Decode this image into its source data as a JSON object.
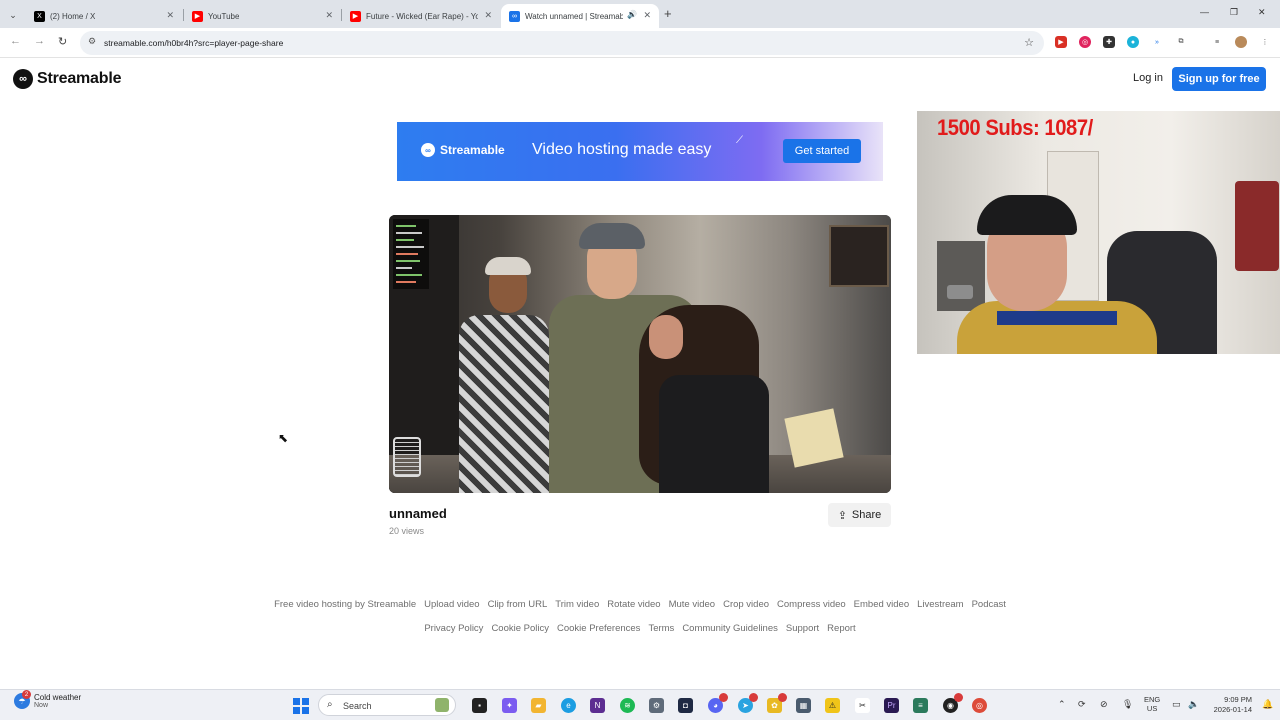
{
  "browser": {
    "tabs": [
      {
        "title": "(2) Home / X",
        "icon": "x-logo-icon",
        "color": "#000000"
      },
      {
        "title": "YouTube",
        "icon": "youtube-icon",
        "color": "#ff0000"
      },
      {
        "title": "Future - Wicked (Ear Rape) - Yo",
        "icon": "youtube-icon",
        "color": "#ff0000"
      },
      {
        "title": "Watch unnamed | Streamabl",
        "icon": "streamable-icon",
        "color": "#1a73e8",
        "active": true
      }
    ],
    "url": "streamable.com/h0br4h?src=player-page-share"
  },
  "site": {
    "brand": "Streamable",
    "login_label": "Log in",
    "signup_label": "Sign up for free",
    "accent": "#1a73e8"
  },
  "banner": {
    "brand": "Streamable",
    "tagline": "Video hosting made easy",
    "cta": "Get started"
  },
  "video": {
    "title": "unnamed",
    "views": "20 views",
    "share_label": "Share"
  },
  "footer": {
    "row1": [
      "Free video hosting by Streamable",
      "Upload video",
      "Clip from URL",
      "Trim video",
      "Rotate video",
      "Mute video",
      "Crop video",
      "Compress video",
      "Embed video",
      "Livestream",
      "Podcast"
    ],
    "row2": [
      "Privacy Policy",
      "Cookie Policy",
      "Cookie Preferences",
      "Terms",
      "Community Guidelines",
      "Support",
      "Report"
    ]
  },
  "webcam": {
    "overlay_text": "1500 Subs: 1087/"
  },
  "taskbar": {
    "weather_title": "Cold weather",
    "weather_sub": "Now",
    "weather_badge": "2",
    "search_label": "Search",
    "lang_top": "ENG",
    "lang_bottom": "US",
    "time": "9:09 PM",
    "date": "2026-01-14"
  }
}
